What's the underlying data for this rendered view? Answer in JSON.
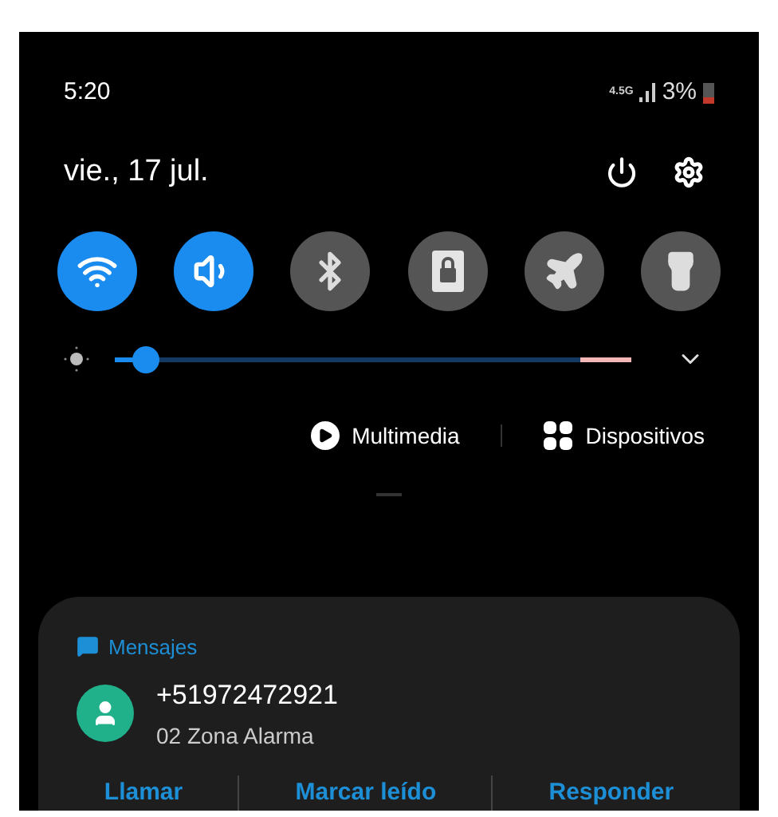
{
  "status_bar": {
    "time": "5:20",
    "network": "4.5G",
    "battery": "3%"
  },
  "header": {
    "date": "vie., 17 jul."
  },
  "toggles": [
    {
      "kind": "wifi",
      "on": true
    },
    {
      "kind": "sound",
      "on": true
    },
    {
      "kind": "bluetooth",
      "on": false
    },
    {
      "kind": "lock",
      "on": false
    },
    {
      "kind": "airplane",
      "on": false
    },
    {
      "kind": "flashlight",
      "on": false
    }
  ],
  "brightness": {
    "level": 0.06
  },
  "media_buttons": [
    {
      "kind": "media",
      "label": "Multimedia"
    },
    {
      "kind": "devices",
      "label": "Dispositivos"
    }
  ],
  "notification": {
    "app": "Mensajes",
    "sender": "+51972472921",
    "message": "02 Zona Alarma",
    "actions": [
      "Llamar",
      "Marcar leído",
      "Responder"
    ]
  }
}
